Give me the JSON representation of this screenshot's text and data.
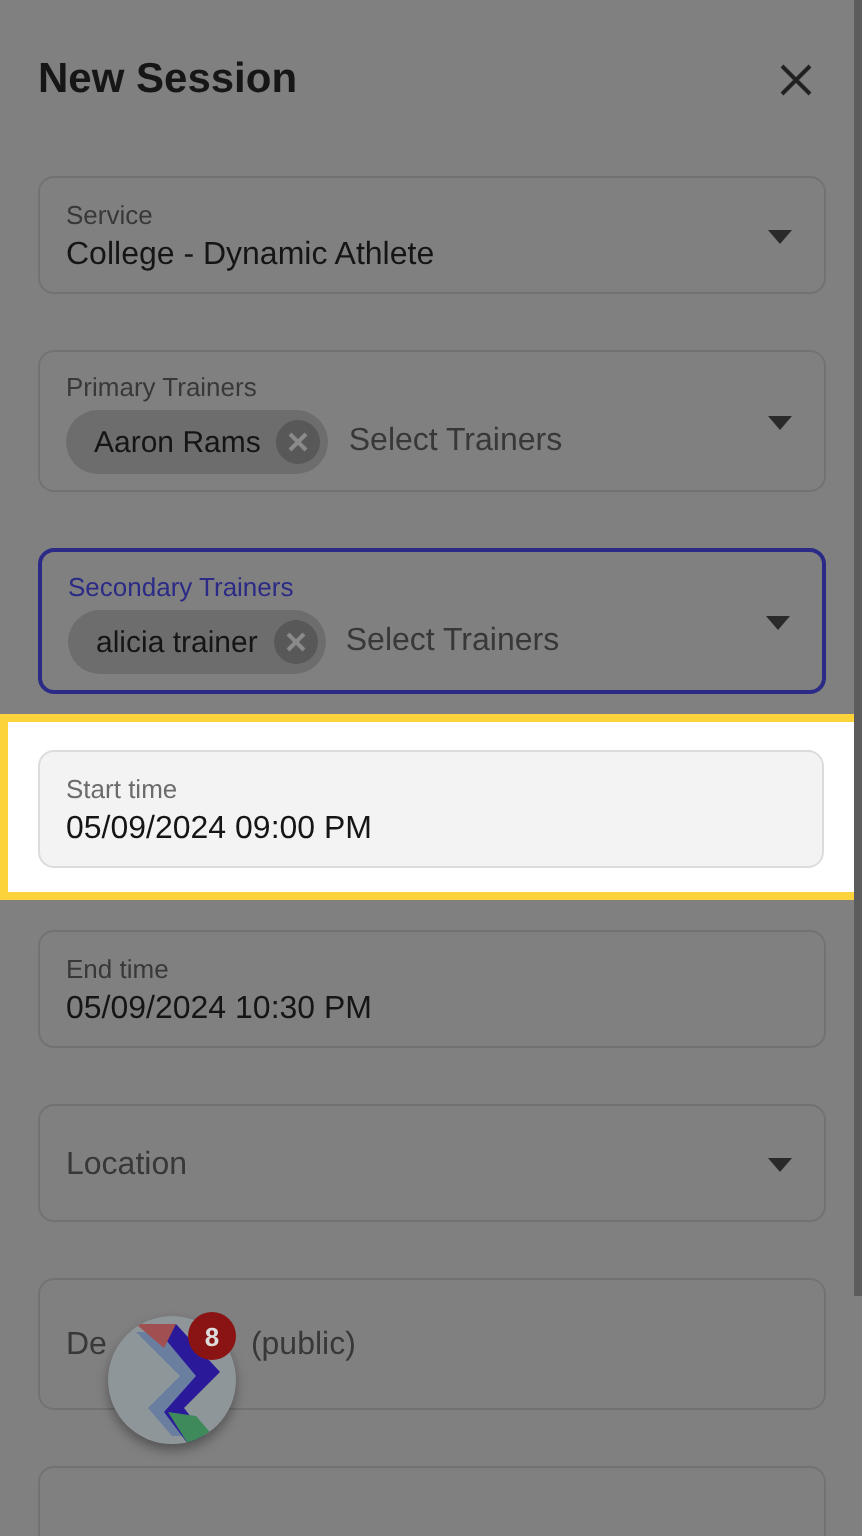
{
  "title": "New Session",
  "fields": [
    {
      "kind": "select",
      "label": "Service",
      "value": "College - Dynamic Athlete",
      "focused": false,
      "highlighted": false
    },
    {
      "kind": "chips",
      "label": "Primary Trainers",
      "chips": [
        "Aaron Rams"
      ],
      "placeholder": "Select Trainers",
      "focused": false,
      "highlighted": false
    },
    {
      "kind": "chips",
      "label": "Secondary Trainers",
      "chips": [
        "alicia trainer"
      ],
      "placeholder": "Select Trainers",
      "focused": true,
      "highlighted": false
    },
    {
      "kind": "text",
      "label": "Start time",
      "value": "05/09/2024 09:00 PM",
      "focused": false,
      "highlighted": true
    },
    {
      "kind": "text",
      "label": "End time",
      "value": "05/09/2024 10:30 PM",
      "focused": false,
      "highlighted": false
    },
    {
      "kind": "select",
      "placeholder": "Location",
      "focused": false,
      "highlighted": false
    },
    {
      "kind": "area",
      "placeholder": "De",
      "placeholder_tail": "(public)",
      "focused": false,
      "highlighted": false
    },
    {
      "kind": "area",
      "focused": false,
      "highlighted": false
    }
  ],
  "floating_button": {
    "badge": "8"
  }
}
